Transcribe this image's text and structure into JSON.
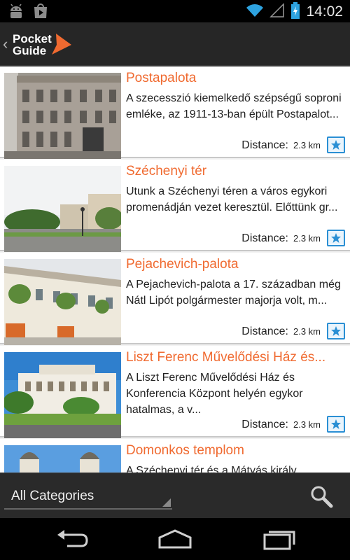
{
  "status_bar": {
    "time": "14:02",
    "left_icons": [
      "android-notification-icon",
      "play-store-icon"
    ],
    "right_icons": [
      "wifi-icon",
      "signal-icon",
      "battery-charging-icon"
    ]
  },
  "app": {
    "logo_line1": "Pocket",
    "logo_line2": "Guide",
    "accent_color": "#f06a30",
    "link_color": "#2a8fd4"
  },
  "list": {
    "distance_label": "Distance:",
    "items": [
      {
        "title": "Postapalota",
        "description": "A szecesszió kiemelkedő szépségű soproni emléke, az 1911-13-ban épült Postapalot...",
        "distance": "2.3 km"
      },
      {
        "title": "Széchenyi tér",
        "description": "Utunk a Széchenyi téren a város egykori promenádján vezet keresztül. Előttünk gr...",
        "distance": "2.3 km"
      },
      {
        "title": "Pejachevich-palota",
        "description": "A Pejachevich-palota a 17. században még Nátl Lipót polgármester majorja volt, m...",
        "distance": "2.3 km"
      },
      {
        "title": "Liszt Ferenc Művelődési Ház és...",
        "description": "A Liszt Ferenc Művelődési Ház és Konferencia Központ helyén egykor hatalmas, a v...",
        "distance": "2.3 km"
      },
      {
        "title": "Domonkos templom",
        "description": "A Széchenyi tér és a Mátyás király",
        "distance": ""
      }
    ]
  },
  "filter": {
    "category_selected": "All Categories"
  },
  "nav": {
    "icons": [
      "back-icon",
      "home-icon",
      "recent-apps-icon"
    ]
  }
}
